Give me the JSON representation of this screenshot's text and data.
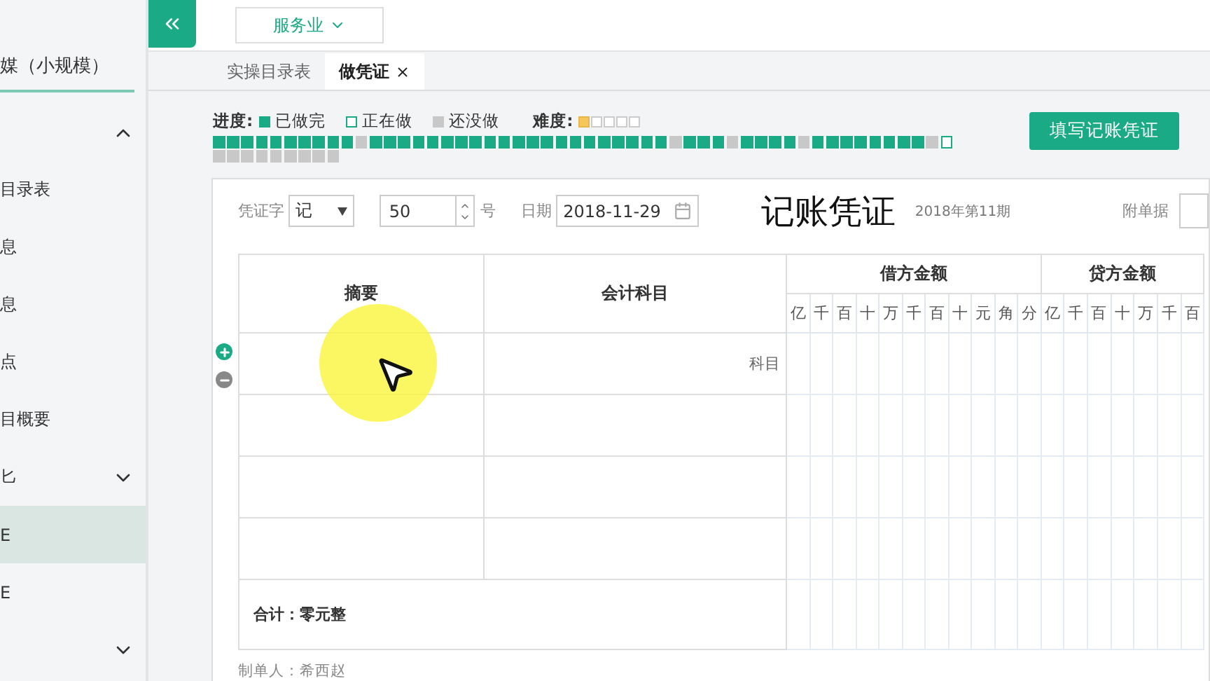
{
  "sidebar": {
    "title": "媒（小规模）",
    "items": [
      {
        "kind": "group",
        "expanded": true
      },
      {
        "kind": "item",
        "label": "目录表",
        "selected": false
      },
      {
        "kind": "item",
        "label": "息",
        "selected": false
      },
      {
        "kind": "item",
        "label": "息",
        "selected": false
      },
      {
        "kind": "item",
        "label": "点",
        "selected": false
      },
      {
        "kind": "item",
        "label": "目概要",
        "selected": false
      },
      {
        "kind": "group",
        "label": "匕",
        "expanded": false
      },
      {
        "kind": "item",
        "label": "E",
        "selected": true
      },
      {
        "kind": "item",
        "label": "E",
        "selected": false
      },
      {
        "kind": "group",
        "expanded": false
      }
    ]
  },
  "industry": {
    "label": "服务业"
  },
  "tabs": [
    {
      "label": "实操目录表",
      "selected": false,
      "closable": false
    },
    {
      "label": "做凭证",
      "selected": true,
      "closable": true
    }
  ],
  "progress": {
    "label": "进度:",
    "legend": [
      {
        "kind": "done",
        "label": "已做完"
      },
      {
        "kind": "doing",
        "label": "正在做"
      },
      {
        "kind": "todo",
        "label": "还没做"
      }
    ],
    "difficulty_label": "难度:",
    "stars": 1,
    "steps": [
      {
        "kind": "done"
      },
      {
        "kind": "done"
      },
      {
        "kind": "done"
      },
      {
        "kind": "done"
      },
      {
        "kind": "done"
      },
      {
        "kind": "done"
      },
      {
        "kind": "done"
      },
      {
        "kind": "done"
      },
      {
        "kind": "done"
      },
      {
        "kind": "done"
      },
      {
        "kind": "todo"
      },
      {
        "kind": "done"
      },
      {
        "kind": "done"
      },
      {
        "kind": "done"
      },
      {
        "kind": "done"
      },
      {
        "kind": "done"
      },
      {
        "kind": "done"
      },
      {
        "kind": "done"
      },
      {
        "kind": "done"
      },
      {
        "kind": "done"
      },
      {
        "kind": "done"
      },
      {
        "kind": "done"
      },
      {
        "kind": "done"
      },
      {
        "kind": "done"
      },
      {
        "kind": "done"
      },
      {
        "kind": "done"
      },
      {
        "kind": "done"
      },
      {
        "kind": "done"
      },
      {
        "kind": "done"
      },
      {
        "kind": "done"
      },
      {
        "kind": "done"
      },
      {
        "kind": "done"
      },
      {
        "kind": "todo"
      },
      {
        "kind": "done"
      },
      {
        "kind": "done"
      },
      {
        "kind": "done"
      },
      {
        "kind": "todo"
      },
      {
        "kind": "done"
      },
      {
        "kind": "done"
      },
      {
        "kind": "done"
      },
      {
        "kind": "done"
      },
      {
        "kind": "todo"
      },
      {
        "kind": "done"
      },
      {
        "kind": "done"
      },
      {
        "kind": "done"
      },
      {
        "kind": "done"
      },
      {
        "kind": "done"
      },
      {
        "kind": "done"
      },
      {
        "kind": "done"
      },
      {
        "kind": "done"
      },
      {
        "kind": "todo"
      },
      {
        "kind": "doing"
      },
      {
        "kind": "todo"
      },
      {
        "kind": "todo"
      },
      {
        "kind": "todo"
      },
      {
        "kind": "todo"
      },
      {
        "kind": "todo"
      },
      {
        "kind": "todo"
      },
      {
        "kind": "todo"
      },
      {
        "kind": "todo"
      },
      {
        "kind": "todo"
      }
    ]
  },
  "fill_button": "填写记账凭证",
  "voucher": {
    "word_label": "凭证字",
    "word": "记",
    "number": "50",
    "number_suffix": "号",
    "date_label": "日期",
    "date": "2018-11-29",
    "title": "记账凭证",
    "period": "2018年第11期",
    "attachments_label": "附单据",
    "columns": {
      "summary": "摘要",
      "account": "会计科目",
      "debit": "借方金额",
      "credit": "贷方金额"
    },
    "debit_digits": [
      "亿",
      "千",
      "百",
      "十",
      "万",
      "千",
      "百",
      "十",
      "元",
      "角",
      "分"
    ],
    "credit_digits": [
      "亿",
      "千",
      "百",
      "十",
      "万",
      "千",
      "百"
    ],
    "rows": [
      {
        "account_placeholder": "科目"
      },
      {},
      {},
      {}
    ],
    "total": "合计：零元整",
    "maker": "制单人：希西赵"
  }
}
